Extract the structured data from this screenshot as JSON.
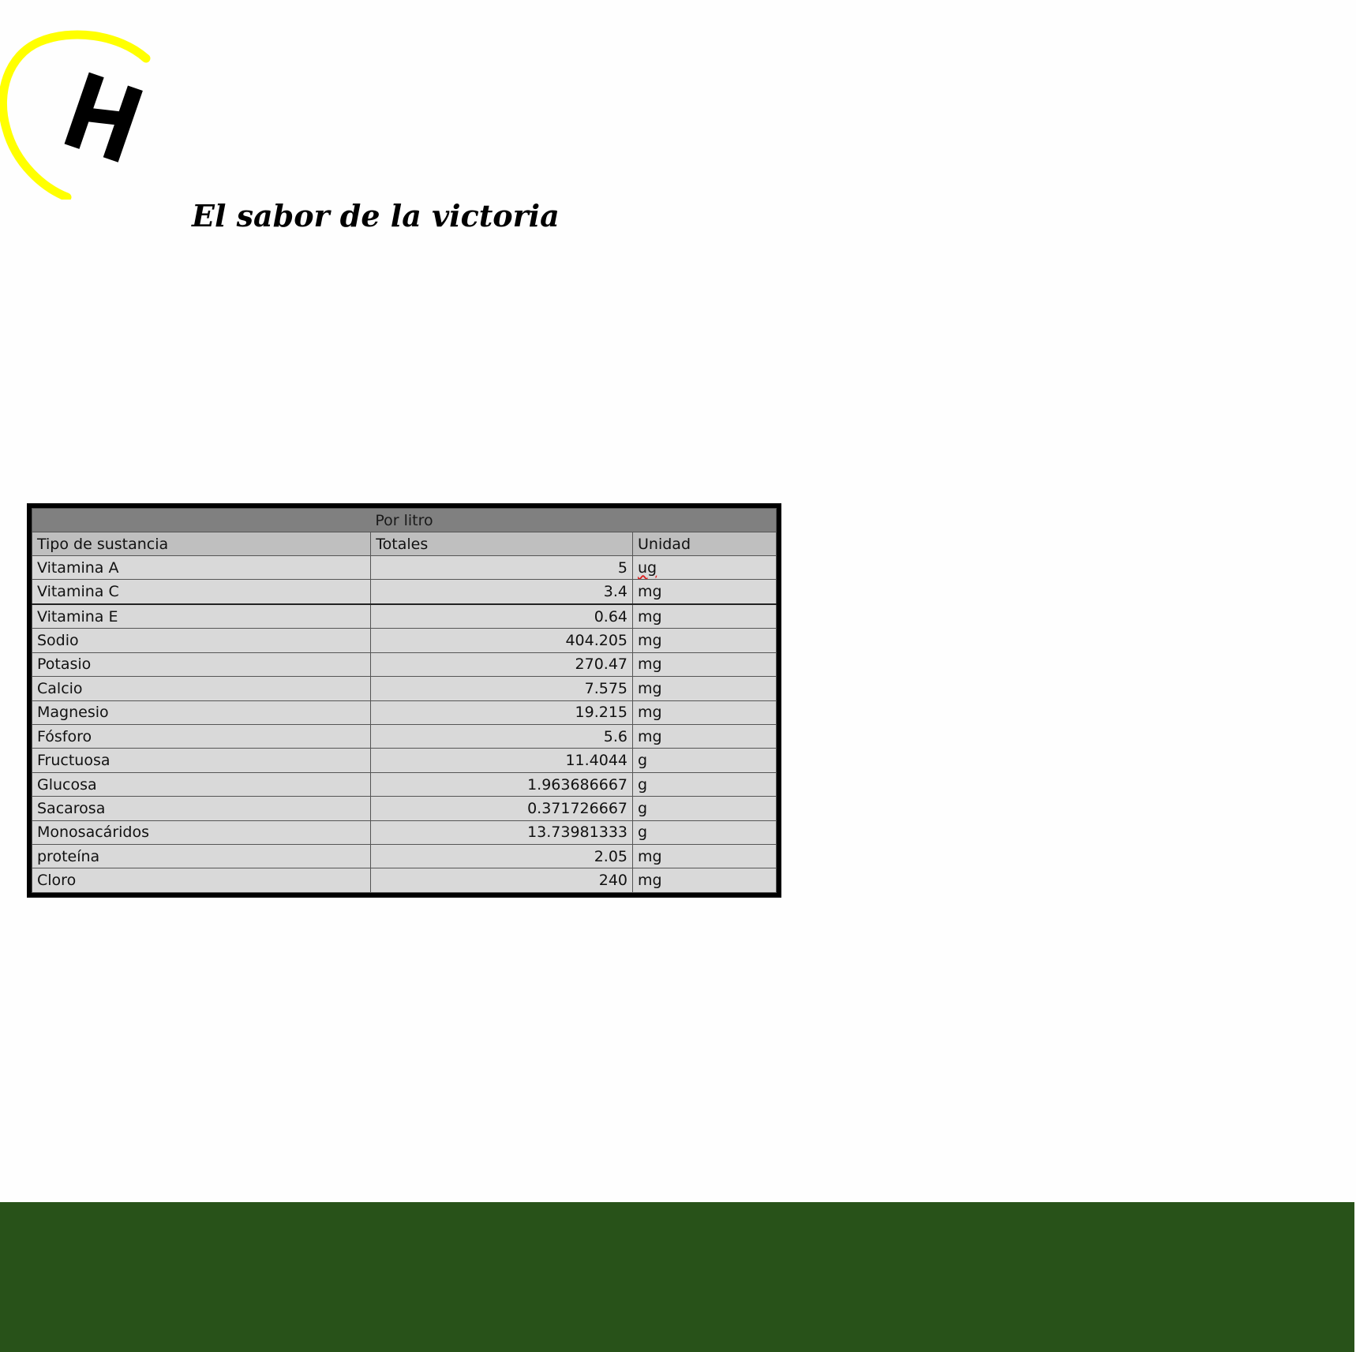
{
  "brand": {
    "logo_icon": "brand-logo-h-with-yellow-arc",
    "logo_colors": {
      "arc": "#ffff00",
      "mark": "#000000"
    },
    "slogan": "El sabor de la victoria"
  },
  "nutrition_table": {
    "group_header": "Por litro",
    "columns": [
      "Tipo de sustancia",
      "Totales",
      "Unidad"
    ],
    "rows": [
      {
        "name": "Vitamina A",
        "total": "5",
        "unit": "ug"
      },
      {
        "name": "Vitamina C",
        "total": "3.4",
        "unit": "mg"
      },
      {
        "name": "Vitamina E",
        "total": "0.64",
        "unit": "mg"
      },
      {
        "name": "Sodio",
        "total": "404.205",
        "unit": "mg"
      },
      {
        "name": "Potasio",
        "total": "270.47",
        "unit": "mg"
      },
      {
        "name": "Calcio",
        "total": "7.575",
        "unit": "mg"
      },
      {
        "name": "Magnesio",
        "total": "19.215",
        "unit": "mg"
      },
      {
        "name": "Fósforo",
        "total": "5.6",
        "unit": "mg"
      },
      {
        "name": "Fructuosa",
        "total": "11.4044",
        "unit": "g"
      },
      {
        "name": "Glucosa",
        "total": "1.963686667",
        "unit": "g"
      },
      {
        "name": "Sacarosa",
        "total": "0.371726667",
        "unit": "g"
      },
      {
        "name": "Monosacáridos",
        "total": "13.73981333",
        "unit": "g"
      },
      {
        "name": "proteína",
        "total": "2.05",
        "unit": "mg"
      },
      {
        "name": "Cloro",
        "total": "240",
        "unit": "mg"
      }
    ]
  },
  "colors": {
    "footer_band": "#285219",
    "group_header_bg": "#808080",
    "column_header_bg": "#bfbfbf",
    "cell_bg": "#d9d9d9"
  }
}
